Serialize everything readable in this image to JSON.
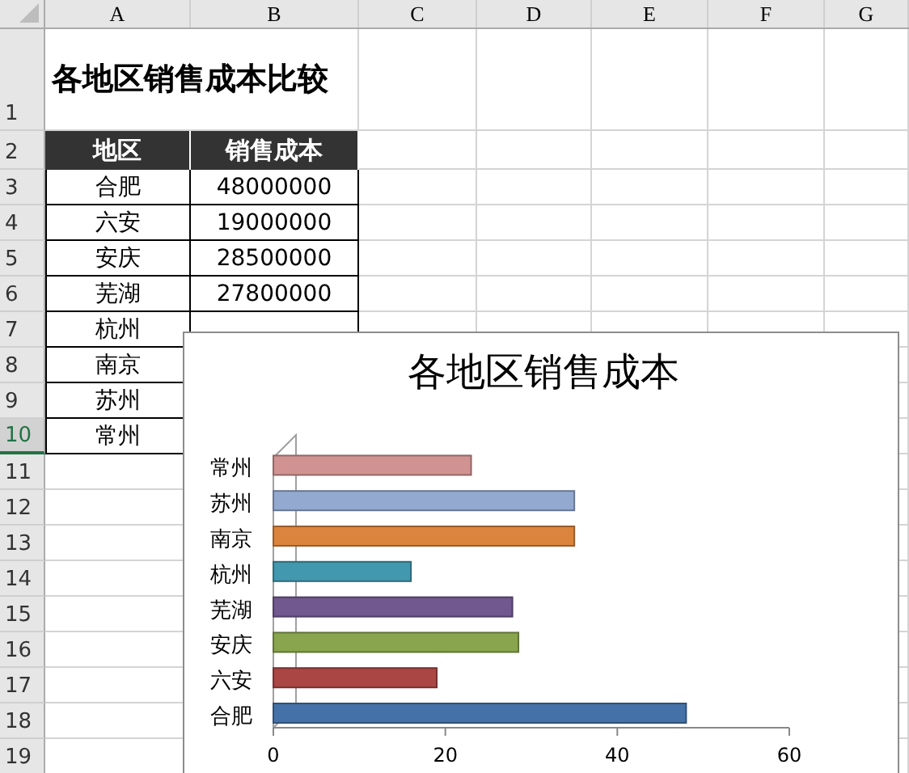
{
  "sheet": {
    "columns": [
      "A",
      "B",
      "C",
      "D",
      "E",
      "F",
      "G"
    ],
    "rows": [
      {
        "number": "1",
        "kind": "title",
        "selected": false,
        "cells": [
          "各地区销售成本比较"
        ]
      },
      {
        "number": "2",
        "kind": "header",
        "selected": false,
        "cells": [
          "地区",
          "销售成本"
        ]
      },
      {
        "number": "3",
        "kind": "data",
        "selected": false,
        "cells": [
          "合肥",
          "48000000"
        ]
      },
      {
        "number": "4",
        "kind": "data",
        "selected": false,
        "cells": [
          "六安",
          "19000000"
        ]
      },
      {
        "number": "5",
        "kind": "data",
        "selected": false,
        "cells": [
          "安庆",
          "28500000"
        ]
      },
      {
        "number": "6",
        "kind": "data",
        "selected": false,
        "cells": [
          "芜湖",
          "27800000"
        ]
      },
      {
        "number": "7",
        "kind": "data",
        "selected": false,
        "cells": [
          "杭州"
        ]
      },
      {
        "number": "8",
        "kind": "data",
        "selected": false,
        "cells": [
          "南京"
        ]
      },
      {
        "number": "9",
        "kind": "data",
        "selected": false,
        "cells": [
          "苏州"
        ]
      },
      {
        "number": "10",
        "kind": "data",
        "selected": true,
        "cells": [
          "常州"
        ]
      },
      {
        "number": "11",
        "kind": "empty",
        "selected": false
      },
      {
        "number": "12",
        "kind": "empty",
        "selected": false
      },
      {
        "number": "13",
        "kind": "empty",
        "selected": false
      },
      {
        "number": "14",
        "kind": "empty",
        "selected": false
      },
      {
        "number": "15",
        "kind": "empty",
        "selected": false
      },
      {
        "number": "16",
        "kind": "empty",
        "selected": false
      },
      {
        "number": "17",
        "kind": "empty",
        "selected": false
      },
      {
        "number": "18",
        "kind": "empty",
        "selected": false
      },
      {
        "number": "19",
        "kind": "empty",
        "selected": false
      }
    ]
  },
  "chart": {
    "chart_data": {
      "type": "bar",
      "orientation": "horizontal",
      "title": "各地区销售成本",
      "categories": [
        "常州",
        "苏州",
        "南京",
        "杭州",
        "芜湖",
        "安庆",
        "六安",
        "合肥"
      ],
      "values": [
        23,
        35,
        35,
        16,
        27.8,
        28.5,
        19,
        48
      ],
      "xlim": [
        0,
        60
      ],
      "xticks": [
        0,
        20,
        40,
        60
      ]
    }
  }
}
